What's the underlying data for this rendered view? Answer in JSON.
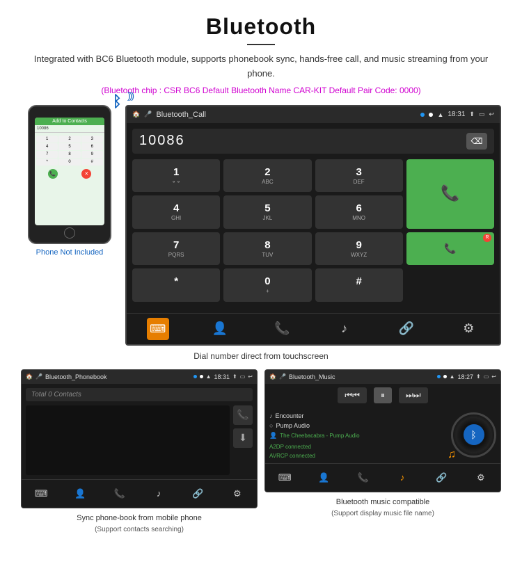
{
  "page": {
    "title": "Bluetooth",
    "description": "Integrated with BC6 Bluetooth module, supports phonebook sync, hands-free call, and music streaming from your phone.",
    "specs": "(Bluetooth chip : CSR BC6    Default Bluetooth Name CAR-KIT    Default Pair Code: 0000)",
    "phone_label": "Phone Not Included",
    "dial_caption": "Dial number direct from touchscreen",
    "phonebook_caption_line1": "Sync phone-book from mobile phone",
    "phonebook_caption_line2": "(Support contacts searching)",
    "music_caption_line1": "Bluetooth music compatible",
    "music_caption_line2": "(Support display music file name)"
  },
  "dialer_screen": {
    "title": "Bluetooth_Call",
    "time": "18:31",
    "number": "10086",
    "keys": [
      {
        "main": "1",
        "sub": "⚬⚬"
      },
      {
        "main": "2",
        "sub": "ABC"
      },
      {
        "main": "3",
        "sub": "DEF"
      },
      {
        "main": "*",
        "sub": ""
      },
      {
        "main": "4",
        "sub": "GHI"
      },
      {
        "main": "5",
        "sub": "JKL"
      },
      {
        "main": "6",
        "sub": "MNO"
      },
      {
        "main": "0",
        "sub": "+"
      },
      {
        "main": "7",
        "sub": "PQRS"
      },
      {
        "main": "8",
        "sub": "TUV"
      },
      {
        "main": "9",
        "sub": "WXYZ"
      },
      {
        "main": "#",
        "sub": ""
      }
    ]
  },
  "phonebook_screen": {
    "title": "Bluetooth_Phonebook",
    "time": "18:31",
    "contacts_placeholder": "Total 0 Contacts"
  },
  "music_screen": {
    "title": "Bluetooth_Music",
    "time": "18:27",
    "tracks": [
      {
        "icon": "♪",
        "name": "Encounter"
      },
      {
        "icon": "○",
        "name": "Pump Audio"
      },
      {
        "icon": "👤",
        "name": "The Cheebacabra - Pump Audio"
      }
    ],
    "connected_lines": [
      "A2DP connected",
      "AVRCP connected"
    ]
  }
}
